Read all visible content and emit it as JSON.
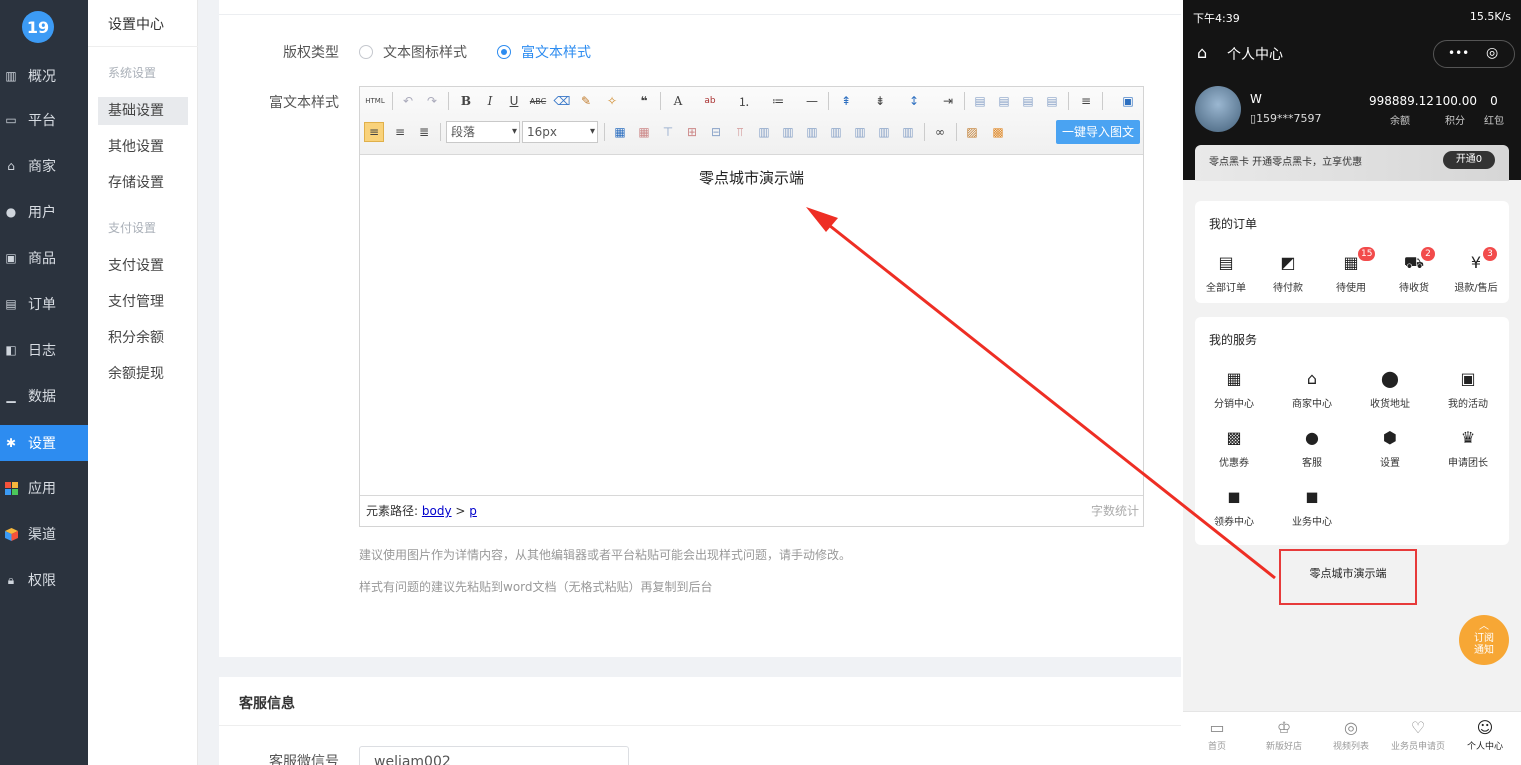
{
  "nav": {
    "logo": "19",
    "items": [
      {
        "label": "概况",
        "icon": "chart-icon"
      },
      {
        "label": "平台",
        "icon": "monitor-icon"
      },
      {
        "label": "商家",
        "icon": "store-icon"
      },
      {
        "label": "用户",
        "icon": "user-icon"
      },
      {
        "label": "商品",
        "icon": "goods-icon"
      },
      {
        "label": "订单",
        "icon": "order-icon"
      },
      {
        "label": "日志",
        "icon": "log-icon"
      },
      {
        "label": "数据",
        "icon": "bar-chart-icon"
      },
      {
        "label": "设置",
        "icon": "gear-icon"
      },
      {
        "label": "应用",
        "icon": "apps-icon"
      },
      {
        "label": "渠道",
        "icon": "cube-icon"
      },
      {
        "label": "权限",
        "icon": "lock-icon"
      }
    ]
  },
  "submenu": {
    "title": "设置中心",
    "group1": "系统设置",
    "group2": "支付设置",
    "items": [
      "基础设置",
      "其他设置",
      "存储设置",
      "支付设置",
      "支付管理",
      "积分余额",
      "余额提现"
    ]
  },
  "form": {
    "copyright_label": "版权类型",
    "radio_text": "文本图标样式",
    "radio_rich": "富文本样式",
    "rich_label": "富文本样式",
    "editor": {
      "html_btn": "HTML",
      "paragraph": "段落",
      "fontsize": "16px",
      "import_btn": "一键导入图文",
      "content": "零点城市演示端",
      "path_label": "元素路径:",
      "path_body": "body",
      "path_gt": ">",
      "path_p": "p",
      "word_count": "字数统计"
    },
    "tip1": "建议使用图片作为详情内容，从其他编辑器或者平台粘贴可能会出现样式问题，请手动修改。",
    "tip2": "样式有问题的建议先粘贴到word文档（无格式粘贴）再复制到后台"
  },
  "service": {
    "title": "客服信息",
    "wechat_label": "客服微信号",
    "wechat_value": "weliam002"
  },
  "phone": {
    "time": "下午4:39",
    "status_right": "15.5K/s",
    "page_title": "个人中心",
    "capsule_more": "•••",
    "capsule_target": "◎",
    "user_name": "W",
    "user_phone": "159***7597",
    "balance": "998889.12",
    "balance_label": "余额",
    "points": "100.00",
    "points_label": "积分",
    "redpack": "0",
    "redpack_label": "红包",
    "vip_text": "零点黑卡   开通零点黑卡，立享优惠",
    "vip_btn": "开通0",
    "orders_title": "我的订单",
    "orders": [
      {
        "label": "全部订单",
        "icon": "doc-icon",
        "badge": ""
      },
      {
        "label": "待付款",
        "icon": "wallet-icon",
        "badge": ""
      },
      {
        "label": "待使用",
        "icon": "gift-icon",
        "badge": "15"
      },
      {
        "label": "待收货",
        "icon": "truck-icon",
        "badge": "2"
      },
      {
        "label": "退款/售后",
        "icon": "yen-icon",
        "badge": "3"
      }
    ],
    "services_title": "我的服务",
    "services": [
      {
        "label": "分销中心",
        "icon": "building-icon"
      },
      {
        "label": "商家中心",
        "icon": "shop-icon"
      },
      {
        "label": "收货地址",
        "icon": "pin-icon"
      },
      {
        "label": "我的活动",
        "icon": "present-icon"
      },
      {
        "label": "优惠券",
        "icon": "coupon-icon"
      },
      {
        "label": "客服",
        "icon": "chat-icon"
      },
      {
        "label": "设置",
        "icon": "hex-icon"
      },
      {
        "label": "申请团长",
        "icon": "crown-icon"
      },
      {
        "label": "领券中心",
        "icon": "bag-icon"
      },
      {
        "label": "业务中心",
        "icon": "briefcase-icon"
      }
    ],
    "footer_text": "零点城市演示端",
    "subscribe": "订阅通知",
    "tabs": [
      "首页",
      "新版好店",
      "视频列表",
      "业务员申请页",
      "个人中心"
    ]
  }
}
